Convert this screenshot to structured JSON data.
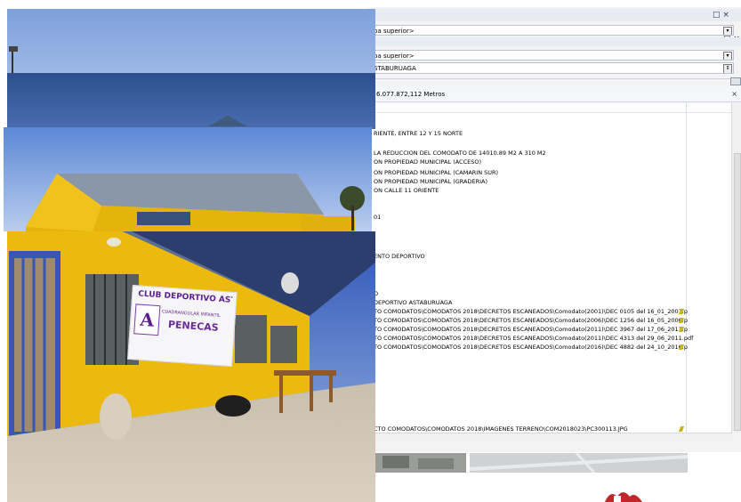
{
  "window": {
    "close_glyph": "□ ×",
    "close_glyph2": "□ ×"
  },
  "combos": [
    {
      "text": "pa superior>"
    },
    {
      "text": "pa superior>"
    },
    {
      "text": "STABURUAGA"
    }
  ],
  "panel_header": "6.077.872,112 Metros",
  "attribute_rows": [
    {
      "text": "RIENTE, ENTRE 12 Y 15 NORTE",
      "pen": false
    },
    {
      "text": "LA REDUCCION DEL COMODATO DE 14010.89 M2 A 310 M2",
      "pen": false
    },
    {
      "text": "ON PROPIEDAD MUNICIPAL (ACCESO)",
      "pen": false
    },
    {
      "text": "ON PROPIEDAD MUNICIPAL (CAMARIN SUR)",
      "pen": false
    },
    {
      "text": "ON PROPIEDAD MUNICIPAL (GRADERIA)",
      "pen": false
    },
    {
      "text": "ON CALLE 11 ORIENTE",
      "pen": false
    },
    {
      "text": "01",
      "pen": false
    },
    {
      "text": "ENTO DEPORTIVO",
      "pen": false
    },
    {
      "text": "O",
      "pen": false
    },
    {
      "text": "DEPORTIVO ASTABURUAGA",
      "pen": false
    },
    {
      "text": "TO COMODATOS\\COMODATOS 2018\\DECRETOS ESCANEADOS\\Comodato(2001)\\DEC 0105 del 16_01_2001.p",
      "pen": true
    },
    {
      "text": "TO COMODATOS\\COMODATOS 2018\\DECRETOS ESCANEADOS\\Comodato(2006)\\DEC 1256 del 16_05_2006.p",
      "pen": true
    },
    {
      "text": "TO COMODATOS\\COMODATOS 2018\\DECRETOS ESCANEADOS\\Comodato(2011)\\DEC 3967 del 17_06_2011.p",
      "pen": true
    },
    {
      "text": "TO COMODATOS\\COMODATOS 2018\\DECRETOS ESCANEADOS\\Comodato(2011)\\DEC 4313 del 29_06_2011.pdf",
      "pen": false
    },
    {
      "text": "TO COMODATOS\\COMODATOS 2018\\DECRETOS ESCANEADOS\\Comodato(2016)\\DEC 4882 del 24_10_2016.p",
      "pen": true
    },
    {
      "text": "CTO COMODATOS\\COMODATOS 2018\\IMAGENES TERRENO\\COM2018023\\PC300113.JPG",
      "pen": true
    }
  ],
  "banner": {
    "line1": "CLUB DEPORTIVO ASTABURUAGA",
    "line2": "CUADRANGULAR INFANTIL",
    "line3": "PENECAS"
  },
  "colors": {
    "sky": "#6d8fd0",
    "wall_yellow": "#e9b60d",
    "frame_blue": "#2d4f9a",
    "pen": "#c7b31a"
  },
  "icons": {
    "pen": "pencil-edit-icon",
    "window_controls": "maximize-close-icon",
    "dropdown": "chevron-down-icon"
  }
}
